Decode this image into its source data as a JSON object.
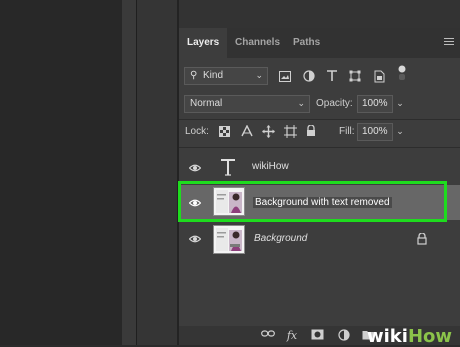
{
  "panel": {
    "tabs": [
      {
        "label": "Layers",
        "active": true
      },
      {
        "label": "Channels",
        "active": false
      },
      {
        "label": "Paths",
        "active": false
      }
    ],
    "menu_icon": "panel-menu-icon"
  },
  "filter": {
    "kind_label": "Kind",
    "icons": [
      "image-filter-icon",
      "adjustment-filter-icon",
      "type-filter-icon",
      "shape-filter-icon",
      "smart-object-filter-icon",
      "filter-toggle-icon"
    ]
  },
  "blend": {
    "mode": "Normal",
    "opacity_label": "Opacity:",
    "opacity_value": "100%"
  },
  "lock": {
    "label": "Lock:",
    "icons": [
      "lock-pixels-icon",
      "lock-image-icon",
      "lock-position-icon",
      "lock-artboard-icon",
      "lock-all-icon"
    ],
    "fill_label": "Fill:",
    "fill_value": "100%"
  },
  "layers": [
    {
      "name": "wikiHow",
      "type": "text",
      "selected": false,
      "locked": false,
      "italic": false
    },
    {
      "name": "Background with text removed",
      "type": "image",
      "selected": true,
      "locked": false,
      "italic": false
    },
    {
      "name": "Background",
      "type": "image",
      "selected": false,
      "locked": true,
      "italic": true
    }
  ],
  "bottom_bar": {
    "icons": [
      "link-layers-icon",
      "fx-icon",
      "mask-icon",
      "adjustment-icon",
      "folder-icon",
      "new-layer-icon",
      "trash-icon"
    ],
    "fx_label": "fx"
  },
  "watermark": {
    "part1": "wiki",
    "part2": "How"
  },
  "colors": {
    "highlight_green": "#1edc1e",
    "selected_row": "#676767",
    "panel_bg": "#3d3d3d"
  }
}
